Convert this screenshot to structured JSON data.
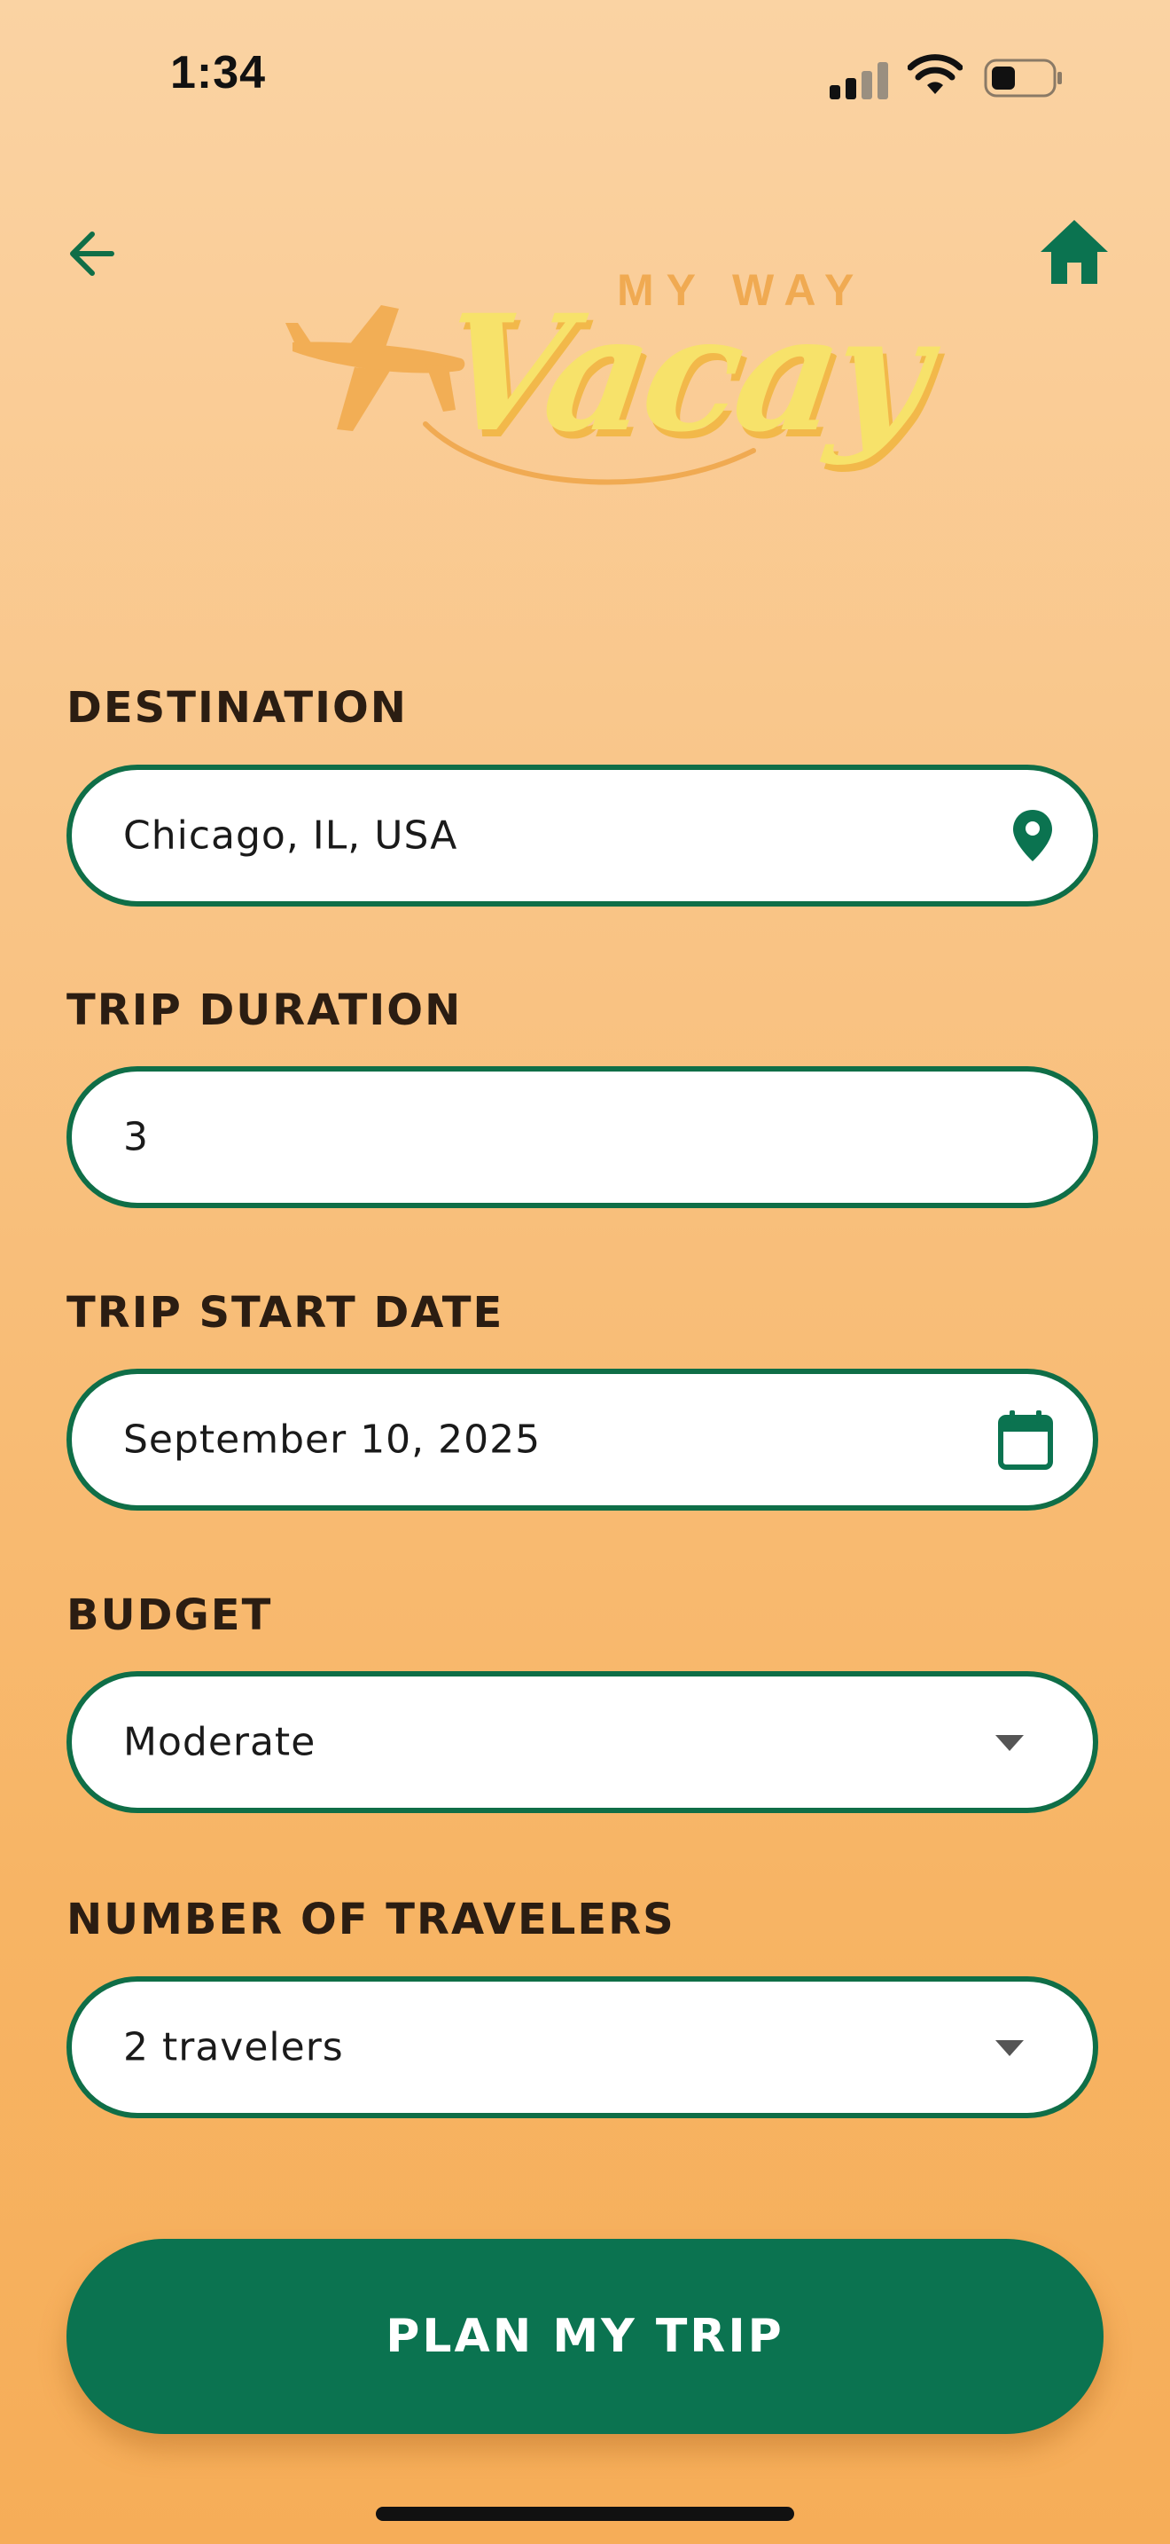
{
  "status_bar": {
    "time": "1:34"
  },
  "header": {
    "back_icon": "arrow-left-icon",
    "home_icon": "home-icon",
    "logo": {
      "sub_text": "MY WAY",
      "main_text": "Vacay"
    }
  },
  "form": {
    "destination": {
      "label": "DESTINATION",
      "value": "Chicago, IL, USA",
      "icon": "location-pin-icon"
    },
    "trip_duration": {
      "label": "TRIP DURATION",
      "value": "3"
    },
    "start_date": {
      "label": "TRIP START DATE",
      "value": "September 10, 2025",
      "icon": "calendar-icon"
    },
    "budget": {
      "label": "BUDGET",
      "value": "Moderate",
      "icon": "dropdown-caret-icon"
    },
    "travelers": {
      "label": "NUMBER OF TRAVELERS",
      "value": "2 travelers",
      "icon": "dropdown-caret-icon"
    },
    "submit_label": "PLAN MY TRIP"
  },
  "colors": {
    "accent": "#0B7350",
    "field_border": "#0F6E47",
    "logo_yellow": "#F7E26A",
    "logo_orange": "#F0AA52"
  }
}
